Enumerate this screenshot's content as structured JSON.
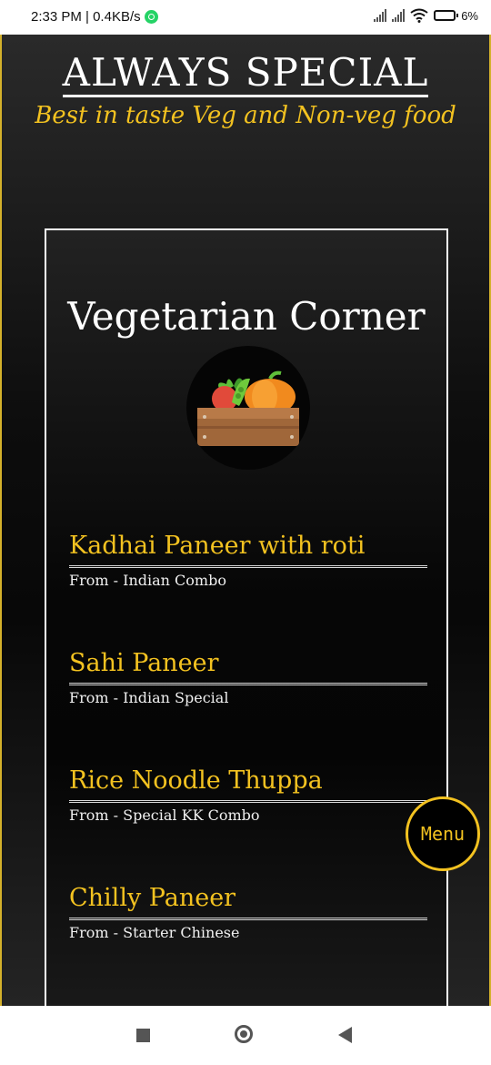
{
  "status_bar": {
    "time_speed": "2:33 PM | 0.4KB/s",
    "battery": "6%"
  },
  "header": {
    "brand": "ALWAYS SPECIAL",
    "tagline": "Best in taste Veg and Non-veg food"
  },
  "section": {
    "title": "Vegetarian Corner",
    "image_icon": "vegetable-crate-icon"
  },
  "items": [
    {
      "name": "Kadhai Paneer with roti",
      "from": "From - Indian Combo"
    },
    {
      "name": "Sahi Paneer",
      "from": "From - Indian Special"
    },
    {
      "name": "Rice Noodle Thuppa",
      "from": "From - Special KK Combo"
    },
    {
      "name": "Chilly Paneer",
      "from": "From - Starter Chinese"
    }
  ],
  "menu_button": "Menu",
  "colors": {
    "accent": "#f3c220",
    "background": "#0b0b0b",
    "border": "#ffffff"
  }
}
